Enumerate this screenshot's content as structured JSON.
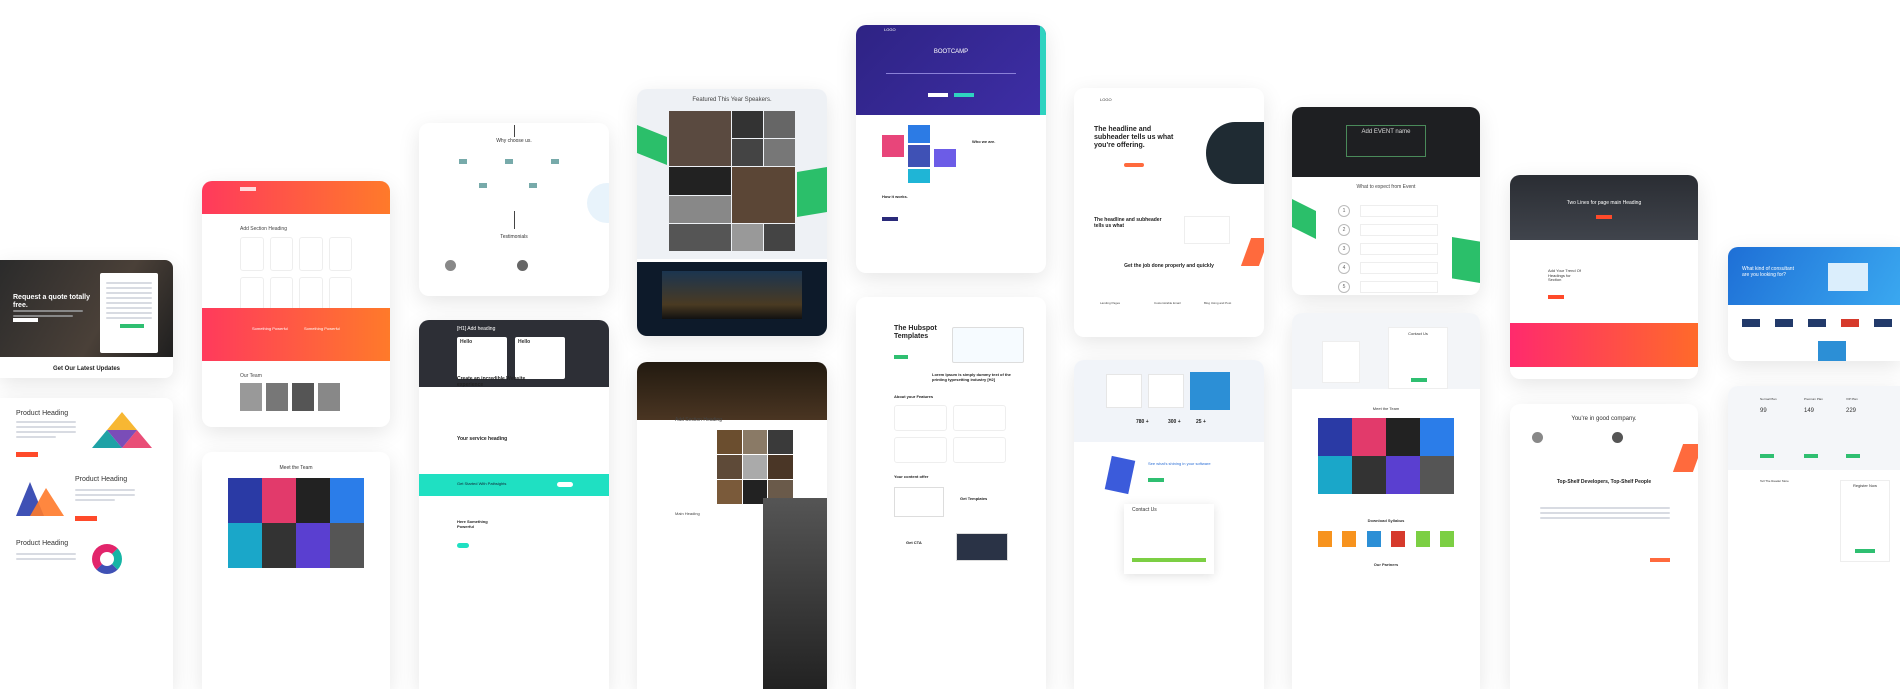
{
  "cards": {
    "quote": {
      "title": "Request a quote totally free.",
      "footer": "Get Our Latest Updates"
    },
    "product": {
      "heading1": "Product Heading",
      "heading2": "Product Heading",
      "heading3": "Product Heading"
    },
    "red": {
      "add_section": "Add Section Heading",
      "feature1": "Something Powerful",
      "feature2": "Something Powerful",
      "team": "Our Team"
    },
    "team_bottom": {
      "title": "Meet the Team"
    },
    "why": {
      "title": "Why choose us.",
      "testimonials": "Testimonials"
    },
    "dark_heading": {
      "add_heading": "[H1] Add heading",
      "hello1": "Hello",
      "hello2": "Hello",
      "create": "Create an incredible Website experience",
      "service": "Your service heading",
      "started": "Get Started With Pathsights",
      "powerful": "Here Something Powerful"
    },
    "speakers": {
      "title": "Featured This Year Speakers."
    },
    "night": {
      "add_section": "Add Section Heading",
      "main": "Main Heading"
    },
    "bootcamp": {
      "logo": "LOGO",
      "title": "BOOTCAMP",
      "who": "Who we are.",
      "how": "How it works."
    },
    "hubspot": {
      "title": "The Hubspot Templates",
      "lorem": "Lorem Ipsum is simply dummy text of the printing typesetting industry [H2]",
      "features": "About your Features",
      "content": "Your content offer",
      "templates": "Get Templates",
      "get_cta": "Get CTA"
    },
    "headline": {
      "logo": "LOGO",
      "h1": "The headline and subheader tells us what you're offering.",
      "h2": "The headline and subheader tells us what",
      "job": "Get the job done properly and quickly",
      "f1": "Landing Pages",
      "f2": "Customizable Email",
      "f3": "Blog Using and Post"
    },
    "stats": {
      "n1": "780 +",
      "n2": "300 +",
      "n3": "25 +",
      "see": "See what's shining in your software",
      "contact": "Contact Us"
    },
    "event": {
      "title": "Add EVENT name",
      "expect": "What to expect from Event",
      "steps": [
        "1",
        "2",
        "3",
        "4",
        "5"
      ]
    },
    "event2": {
      "contact": "Contact Us",
      "team": "Meet the Team",
      "download": "Download Syllabus",
      "partners": "Our Partners"
    },
    "dark_red": {
      "title": "Two Lines for page main Heading",
      "list": "Add Your Trend Of Headings for Section"
    },
    "good": {
      "title": "You're in good company.",
      "devs": "Top-Shelf Developers, Top-Shelf People"
    },
    "blue": {
      "title": "What kind of consultant are you looking for?"
    },
    "pricing": {
      "p1": "Normal Plan",
      "p2": "Premium Plan",
      "p3": "VIP Plan",
      "v1": "99",
      "v2": "149",
      "v3": "229",
      "reg": "Register Now",
      "tell": "Tell The Reader More"
    }
  },
  "colors": {
    "red": "#ff5a3d",
    "purple": "#3a2a93",
    "teal": "#2fd3c0",
    "green": "#36b37e",
    "blue": "#2c8fd6",
    "dark": "#2a2d33"
  }
}
